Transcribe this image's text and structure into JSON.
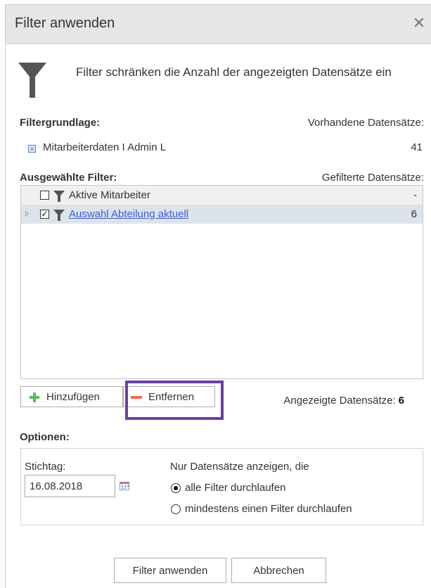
{
  "dialog": {
    "title": "Filter anwenden",
    "close_glyph": "✕",
    "info_text": "Filter schränken die Anzahl der angezeigten Datensätze ein"
  },
  "basis": {
    "label": "Filtergrundlage:",
    "records_label": "Vorhandene Datensätze:",
    "source_name": "Mitarbeiterdaten I Admin L",
    "source_count": "41"
  },
  "filters": {
    "label": "Ausgewählte Filter:",
    "filtered_label": "Gefilterte Datensätze:",
    "rows": [
      {
        "name": "Aktive Mitarbeiter",
        "count": "-",
        "checked": false,
        "is_link": false
      },
      {
        "name": "Auswahl Abteilung aktuell",
        "count": "6",
        "checked": true,
        "is_link": true
      }
    ]
  },
  "actions": {
    "add_label": "Hinzufügen",
    "remove_label": "Entfernen",
    "shown_label": "Angezeigte Datensätze:",
    "shown_value": "6"
  },
  "options": {
    "label": "Optionen:",
    "date_label": "Stichtag:",
    "date_value": "16.08.2018",
    "show_label": "Nur Datensätze anzeigen, die",
    "radio_all": "alle Filter durchlaufen",
    "radio_any": "mindestens einen Filter durchlaufen",
    "selected": "all"
  },
  "footer": {
    "apply_label": "Filter anwenden",
    "cancel_label": "Abbrechen"
  },
  "colors": {
    "titlebar": "#e6e6e6",
    "selected_row": "#dce3ea",
    "link": "#3f5bd1",
    "add_icon": "#5cb85c",
    "remove_icon": "#ee6a4c",
    "highlight_frame": "#6a3fa6"
  }
}
